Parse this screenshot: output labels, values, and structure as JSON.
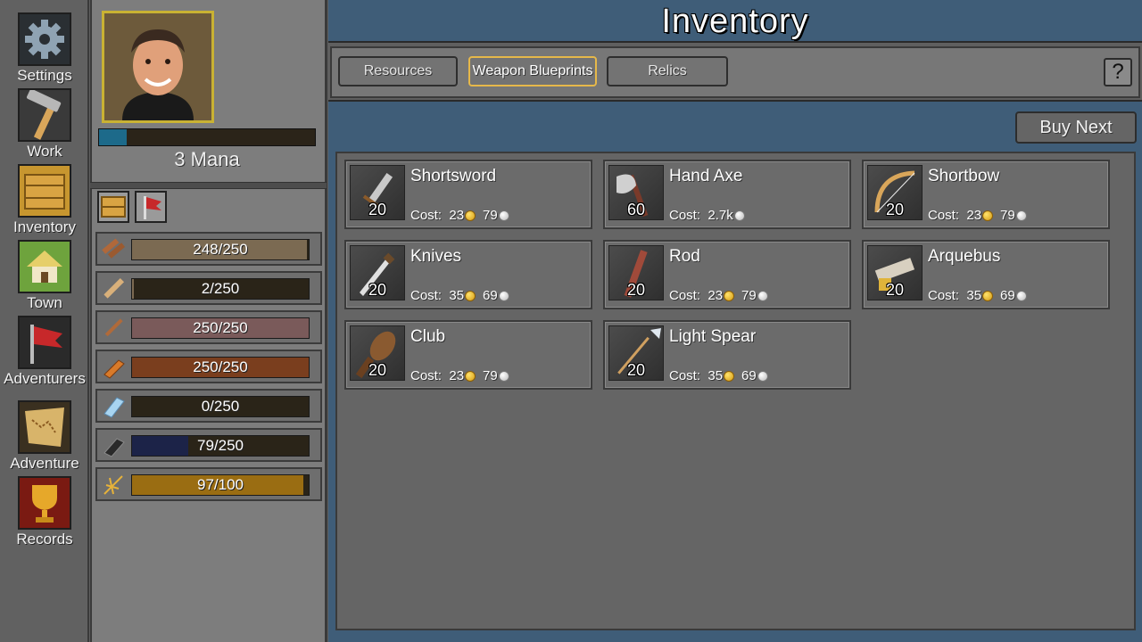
{
  "nav": {
    "items": [
      {
        "label": "Settings",
        "icon": "gear-icon"
      },
      {
        "label": "Work",
        "icon": "hammer-icon"
      },
      {
        "label": "Inventory",
        "icon": "crate-icon"
      },
      {
        "label": "Town",
        "icon": "house-icon"
      },
      {
        "label": "Adventurers",
        "icon": "flag-icon"
      },
      {
        "label": "Adventure",
        "icon": "map-icon"
      },
      {
        "label": "Records",
        "icon": "trophy-icon"
      }
    ]
  },
  "character": {
    "mana_label": "3 Mana",
    "mana_fraction": 0.13,
    "equipment": [
      {
        "icon": "crate-icon"
      },
      {
        "icon": "axe-flag-icon"
      }
    ]
  },
  "resources": [
    {
      "text": "248/250",
      "fraction": 0.992,
      "icon": "logs-icon",
      "color": "#7b6a52"
    },
    {
      "text": "2/250",
      "fraction": 0.008,
      "icon": "plank-icon",
      "color": "#7b6a52"
    },
    {
      "text": "250/250",
      "fraction": 1.0,
      "icon": "stick-icon",
      "color": "#7a5a5a"
    },
    {
      "text": "250/250",
      "fraction": 1.0,
      "icon": "copper-bar-icon",
      "color": "#7a3e1e"
    },
    {
      "text": "0/250",
      "fraction": 0.0,
      "icon": "crystal-icon",
      "color": "#5a7aa0"
    },
    {
      "text": "79/250",
      "fraction": 0.316,
      "icon": "iron-bar-icon",
      "color": "#1c2348"
    },
    {
      "text": "97/100",
      "fraction": 0.97,
      "icon": "sparkle-icon",
      "color": "#9a6d12"
    }
  ],
  "header": {
    "title": "Inventory"
  },
  "tabs": [
    {
      "label": "Resources",
      "active": false
    },
    {
      "label": "Weapon Blueprints",
      "active": true
    },
    {
      "label": "Relics",
      "active": false
    }
  ],
  "help_label": "?",
  "buy_next_label": "Buy Next",
  "cost_prefix": "Cost:",
  "blueprints": [
    {
      "name": "Shortsword",
      "qty": "20",
      "gold": "23",
      "silver": "79",
      "icon": "shortsword-icon"
    },
    {
      "name": "Hand Axe",
      "qty": "60",
      "gold": "2.7k",
      "silver": "",
      "icon": "hand-axe-icon"
    },
    {
      "name": "Shortbow",
      "qty": "20",
      "gold": "23",
      "silver": "79",
      "icon": "shortbow-icon"
    },
    {
      "name": "Knives",
      "qty": "20",
      "gold": "35",
      "silver": "69",
      "icon": "knives-icon"
    },
    {
      "name": "Rod",
      "qty": "20",
      "gold": "23",
      "silver": "79",
      "icon": "rod-icon"
    },
    {
      "name": "Arquebus",
      "qty": "20",
      "gold": "35",
      "silver": "69",
      "icon": "arquebus-icon"
    },
    {
      "name": "Club",
      "qty": "20",
      "gold": "23",
      "silver": "79",
      "icon": "club-icon"
    },
    {
      "name": "Light Spear",
      "qty": "20",
      "gold": "35",
      "silver": "69",
      "icon": "spear-icon"
    }
  ]
}
